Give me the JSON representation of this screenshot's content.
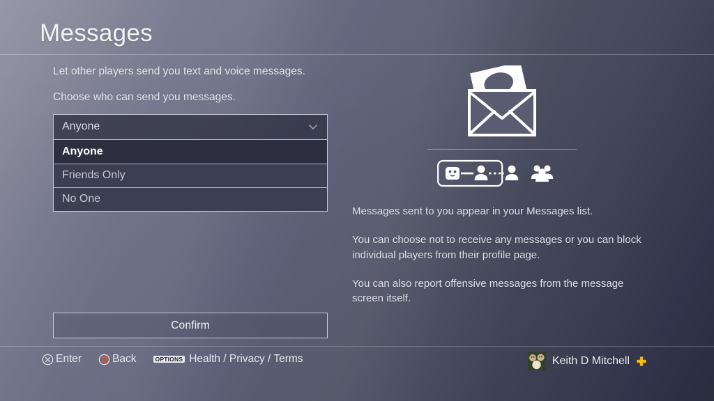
{
  "header": {
    "title": "Messages"
  },
  "left": {
    "intro_text": "Let other players send you text and voice messages.",
    "choose_text": "Choose who can send you messages.",
    "dropdown": {
      "name": "message-privacy-select",
      "selected_value": "Anyone",
      "expanded": true,
      "chevron_icon": "chevron-down-icon",
      "options": [
        {
          "label": "Anyone",
          "selected": true
        },
        {
          "label": "Friends Only",
          "selected": false
        },
        {
          "label": "No One",
          "selected": false
        }
      ]
    },
    "confirm_label": "Confirm"
  },
  "right": {
    "hero_icon": "envelope-message-icon",
    "privacy_scale": {
      "icons": [
        "smiley-face-icon",
        "person-icon",
        "person-icon",
        "group-people-icon"
      ],
      "highlighted_group": [
        "smiley-face-icon",
        "person-icon"
      ]
    },
    "paragraphs": [
      "Messages sent to you appear in your Messages list.",
      "You can choose not to receive any messages or you can block individual players from their profile page.",
      "You can also report offensive messages from the message screen itself."
    ]
  },
  "footer": {
    "hints": [
      {
        "icon": "cross-button-icon",
        "label": "Enter"
      },
      {
        "icon": "circle-button-icon",
        "label": "Back"
      },
      {
        "icon": "options-button-badge",
        "badge_text": "OPTIONS",
        "label": "Health / Privacy / Terms"
      }
    ],
    "user": {
      "avatar_icon": "user-avatar",
      "name": "Keith D Mitchell",
      "plus_icon": "ps-plus-icon"
    }
  },
  "colors": {
    "background_light": "#8d8e9e",
    "background_dark": "#2a2d3e",
    "field_fill": "#3c3e51",
    "selected_fill": "#2d2f41",
    "text_primary": "#f0f1f5",
    "text_secondary": "#c9cad4",
    "circle_button_accent": "#d8541f",
    "ps_plus_gold": "#f3c018"
  }
}
